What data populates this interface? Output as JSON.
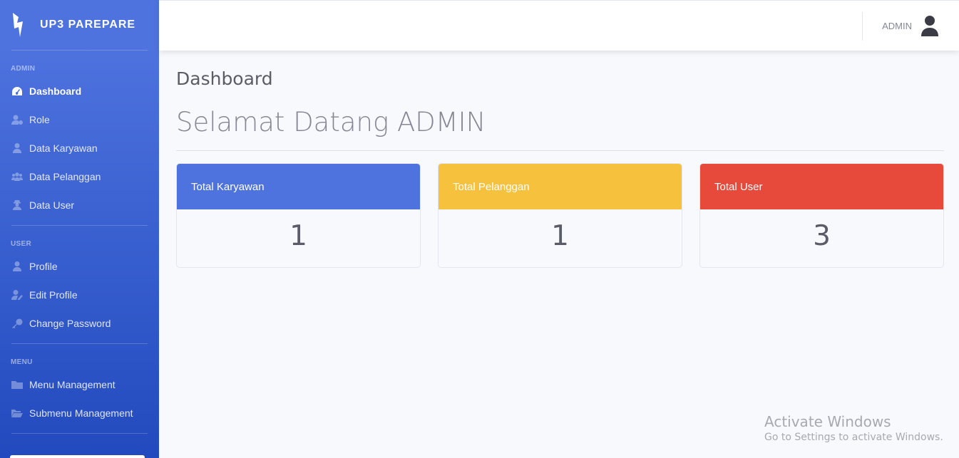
{
  "brand": {
    "name": "UP3 PAREPARE",
    "icon": "bolt-icon"
  },
  "sidebar": {
    "sections": [
      {
        "heading": "ADMIN",
        "items": [
          {
            "label": "Dashboard",
            "icon": "tachometer-icon",
            "active": true
          },
          {
            "label": "Role",
            "icon": "user-cog-icon"
          },
          {
            "label": "Data Karyawan",
            "icon": "user-tie-icon"
          },
          {
            "label": "Data Pelanggan",
            "icon": "users-icon"
          },
          {
            "label": "Data User",
            "icon": "user-secret-icon"
          }
        ]
      },
      {
        "heading": "USER",
        "items": [
          {
            "label": "Profile",
            "icon": "user-icon"
          },
          {
            "label": "Edit Profile",
            "icon": "user-edit-icon"
          },
          {
            "label": "Change Password",
            "icon": "key-icon"
          }
        ]
      },
      {
        "heading": "MENU",
        "items": [
          {
            "label": "Menu Management",
            "icon": "folder-icon"
          },
          {
            "label": "Submenu Management",
            "icon": "folder-open-icon"
          }
        ]
      }
    ]
  },
  "topbar": {
    "user_name": "ADMIN",
    "avatar_icon": "user-avatar-icon"
  },
  "main": {
    "page_title": "Dashboard",
    "welcome": "Selamat Datang ADMIN",
    "cards": [
      {
        "title": "Total Karyawan",
        "value": "1",
        "color": "#4e73df"
      },
      {
        "title": "Total Pelanggan",
        "value": "1",
        "color": "#f6c23e"
      },
      {
        "title": "Total User",
        "value": "3",
        "color": "#e74a3b"
      }
    ]
  },
  "watermark": {
    "line1": "Activate Windows",
    "line2": "Go to Settings to activate Windows."
  }
}
